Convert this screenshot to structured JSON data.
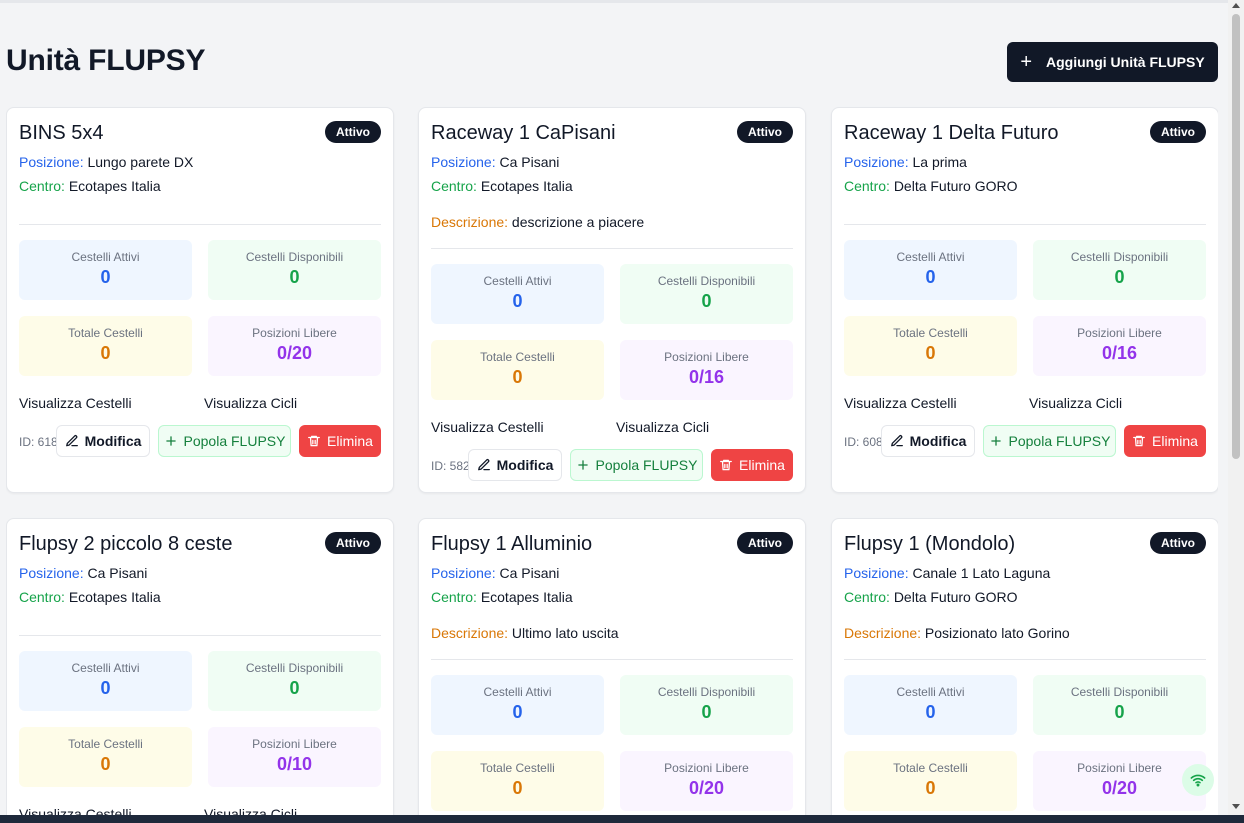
{
  "page": {
    "title": "Unità FLUPSY",
    "add_button_label": "Aggiungi Unità FLUPSY"
  },
  "labels": {
    "posizione": "Posizione:",
    "centro": "Centro:",
    "descrizione": "Descrizione:",
    "cestelli_attivi": "Cestelli Attivi",
    "cestelli_disponibili": "Cestelli Disponibili",
    "totale_cestelli": "Totale Cestelli",
    "posizioni_libere": "Posizioni Libere",
    "visualizza_cestelli": "Visualizza Cestelli",
    "visualizza_cicli": "Visualizza Cicli",
    "modifica": "Modifica",
    "popola": "Popola FLUPSY",
    "elimina": "Elimina"
  },
  "colors": {
    "primary": "#111827",
    "blue": "#2563eb",
    "green": "#16a34a",
    "orange": "#d97706",
    "purple": "#9333ea",
    "danger": "#ef4444"
  },
  "cards": [
    {
      "title": "BINS 5x4",
      "status": "Attivo",
      "posizione": "Lungo parete DX",
      "centro": "Ecotapes Italia",
      "descrizione": "",
      "cestelli_attivi": "0",
      "cestelli_disponibili": "0",
      "totale_cestelli": "0",
      "posizioni_libere": "0/20",
      "id": "ID: 618"
    },
    {
      "title": "Raceway 1 CaPisani",
      "status": "Attivo",
      "posizione": "Ca Pisani",
      "centro": "Ecotapes Italia",
      "descrizione": "descrizione a piacere",
      "cestelli_attivi": "0",
      "cestelli_disponibili": "0",
      "totale_cestelli": "0",
      "posizioni_libere": "0/16",
      "id": "ID: 582"
    },
    {
      "title": "Raceway 1 Delta Futuro",
      "status": "Attivo",
      "posizione": "La prima",
      "centro": "Delta Futuro GORO",
      "descrizione": "",
      "cestelli_attivi": "0",
      "cestelli_disponibili": "0",
      "totale_cestelli": "0",
      "posizioni_libere": "0/16",
      "id": "ID: 608"
    },
    {
      "title": "Flupsy 2 piccolo 8 ceste",
      "status": "Attivo",
      "posizione": "Ca Pisani",
      "centro": "Ecotapes Italia",
      "descrizione": "",
      "cestelli_attivi": "0",
      "cestelli_disponibili": "0",
      "totale_cestelli": "0",
      "posizioni_libere": "0/10",
      "id": ""
    },
    {
      "title": "Flupsy 1 Alluminio",
      "status": "Attivo",
      "posizione": "Ca Pisani",
      "centro": "Ecotapes Italia",
      "descrizione": "Ultimo lato uscita",
      "cestelli_attivi": "0",
      "cestelli_disponibili": "0",
      "totale_cestelli": "0",
      "posizioni_libere": "0/20",
      "id": ""
    },
    {
      "title": "Flupsy 1 (Mondolo)",
      "status": "Attivo",
      "posizione": "Canale 1 Lato Laguna",
      "centro": "Delta Futuro GORO",
      "descrizione": "Posizionato lato Gorino",
      "cestelli_attivi": "0",
      "cestelli_disponibili": "0",
      "totale_cestelli": "0",
      "posizioni_libere": "0/20",
      "id": ""
    }
  ]
}
